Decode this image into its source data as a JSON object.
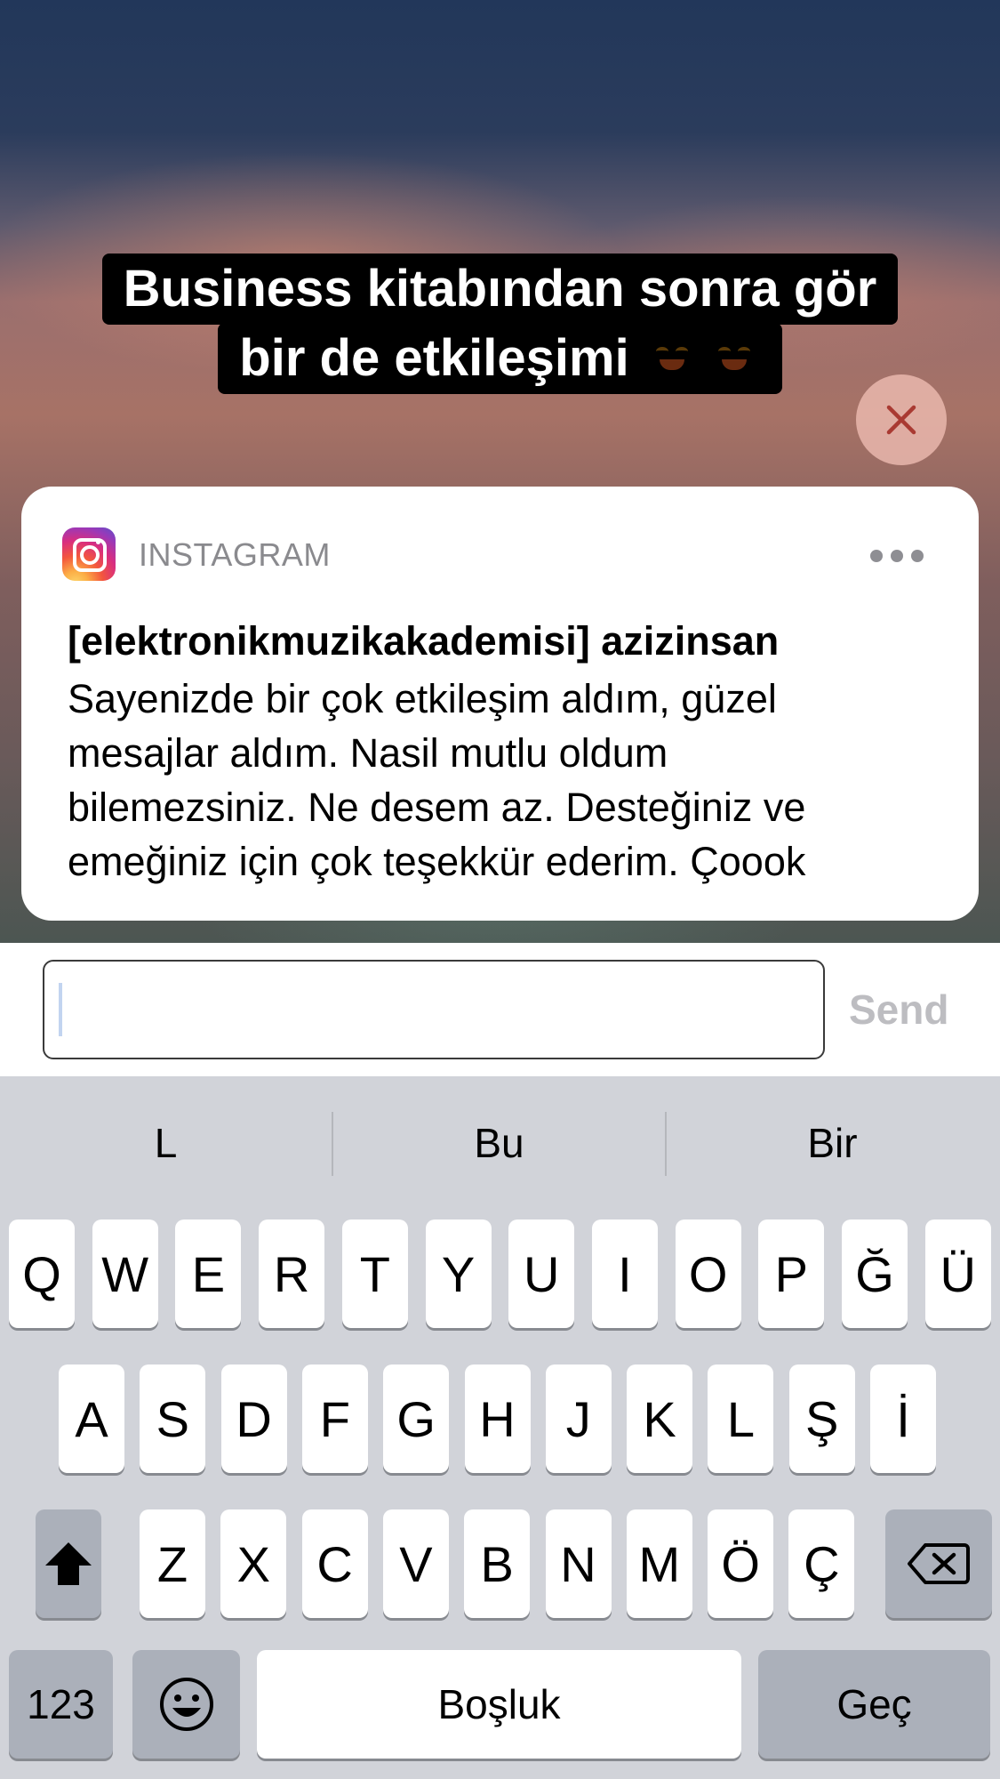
{
  "story": {
    "caption_line1": "Business kitabından sonra gör",
    "caption_line2": "bir de etkileşimi",
    "emoji_icons": [
      "rolling-on-floor-laughing-icon",
      "rolling-on-floor-laughing-icon"
    ]
  },
  "notification": {
    "app_name": "INSTAGRAM",
    "title": "[elektronikmuzikakademisi] azizinsan",
    "body_lines": [
      "Sayenizde bir çok etkileşim aldım, güzel",
      "mesajlar aldım. Nasil mutlu oldum",
      "bilemezsiniz. Ne desem az. Desteğiniz ve",
      "emeğiniz için çok teşekkür ederim. Çoook"
    ]
  },
  "reply": {
    "value": "",
    "send_label": "Send"
  },
  "keyboard": {
    "suggestions": [
      "L",
      "Bu",
      "Bir"
    ],
    "row1": [
      "Q",
      "W",
      "E",
      "R",
      "T",
      "Y",
      "U",
      "I",
      "O",
      "P",
      "Ğ",
      "Ü"
    ],
    "row2": [
      "A",
      "S",
      "D",
      "F",
      "G",
      "H",
      "J",
      "K",
      "L",
      "Ş",
      "İ"
    ],
    "row3": [
      "Z",
      "X",
      "C",
      "V",
      "B",
      "N",
      "M",
      "Ö",
      "Ç"
    ],
    "numbers_label": "123",
    "space_label": "Boşluk",
    "return_label": "Geç"
  },
  "colors": {
    "send_disabled": "#bdbdc1",
    "keyboard_bg": "#d1d3d9"
  }
}
